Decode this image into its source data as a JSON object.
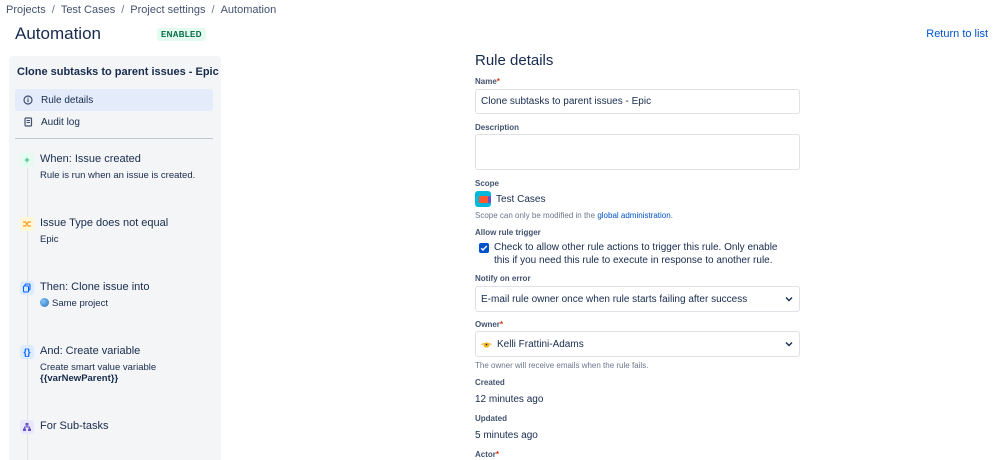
{
  "breadcrumb": [
    "Projects",
    "Test Cases",
    "Project settings",
    "Automation"
  ],
  "breadcrumb_separator": "/",
  "header": {
    "title": "Automation",
    "status": "ENABLED",
    "return_link": "Return to list"
  },
  "sidebar": {
    "rule_name": "Clone subtasks to parent issues - Epic",
    "nav": [
      {
        "label": "Rule details",
        "icon": "info-icon",
        "active": true
      },
      {
        "label": "Audit log",
        "icon": "document-icon",
        "active": false
      }
    ],
    "steps": [
      {
        "icon": "plus-icon",
        "title": "When: Issue created",
        "desc": "Rule is run when an issue is created.",
        "color": "#36b37e"
      },
      {
        "icon": "shuffle-icon",
        "title": "Issue Type does not equal",
        "desc": "Epic",
        "color": "#ffab00"
      },
      {
        "icon": "copy-icon",
        "title": "Then: Clone issue into",
        "desc": "Same project",
        "color": "#0065ff"
      },
      {
        "icon": "braces-icon",
        "title": "And: Create variable",
        "desc": "Create smart value variable",
        "desc2": "{{varNewParent}}",
        "color": "#0065ff"
      },
      {
        "icon": "hierarchy-icon",
        "title": "For Sub-tasks",
        "color": "#6554c0"
      }
    ]
  },
  "details": {
    "title": "Rule details",
    "name_label": "Name",
    "name_value": "Clone subtasks to parent issues - Epic",
    "description_label": "Description",
    "description_value": "",
    "scope_label": "Scope",
    "scope_value": "Test Cases",
    "scope_helper": "Scope can only be modified in the ",
    "scope_helper_link": "global administration",
    "scope_helper_end": ".",
    "allow_trigger_label": "Allow rule trigger",
    "allow_trigger_text": "Check to allow other rule actions to trigger this rule. Only enable this if you need this rule to execute in response to another rule.",
    "allow_trigger_checked": true,
    "notify_label": "Notify on error",
    "notify_value": "E-mail rule owner once when rule starts failing after success",
    "owner_label": "Owner",
    "owner_value": "Kelli Frattini-Adams",
    "owner_helper": "The owner will receive emails when the rule fails.",
    "created_label": "Created",
    "created_value": "12 minutes ago",
    "updated_label": "Updated",
    "updated_value": "5 minutes ago",
    "actor_label": "Actor",
    "required_mark": "*"
  }
}
